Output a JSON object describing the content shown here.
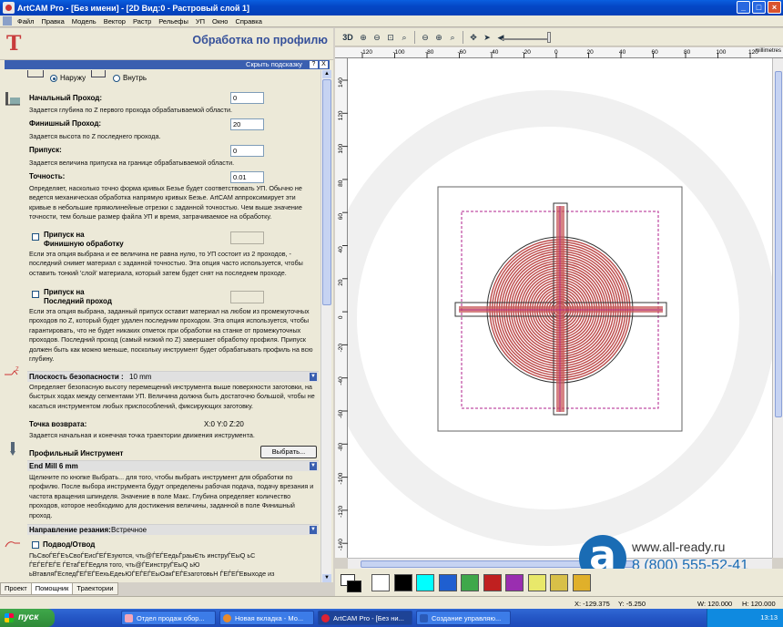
{
  "window": {
    "title": "ArtCAM Pro - [Без имени] - [2D Вид:0 - Растровый слой 1]",
    "buttons": [
      "_",
      "□",
      "×"
    ]
  },
  "menu": [
    "Файл",
    "Правка",
    "Модель",
    "Вектор",
    "Растр",
    "Рельефы",
    "УП",
    "Окно",
    "Справка"
  ],
  "panel": {
    "title": "Обработка по профилю",
    "hint_bar": "Скрыть подсказку",
    "hint_help": "?",
    "hint_close": "X",
    "side": {
      "outside_label": "Наружу",
      "inside_label": "Внутрь",
      "selected": "outside"
    },
    "start_pass": {
      "label": "Начальный Проход:",
      "value": "0",
      "desc": "Задается глубина по Z первого прохода обрабатываемой области."
    },
    "finish_pass": {
      "label": "Финишный Проход:",
      "value": "20",
      "desc": "Задается высота по Z последнего прохода."
    },
    "allowance": {
      "label": "Припуск:",
      "value": "0",
      "desc": "Задается величина припуска на границе обрабатываемой области."
    },
    "tolerance": {
      "label": "Точность:",
      "value": "0.01",
      "desc": "Определяет, насколько точно форма кривых Безье будет соответствовать УП. Обычно не ведется механическая обработка напрямую кривых Безье. ArtCAM аппроксимирует эти кривые в небольшие прямолинейные отрезки с заданной точностью. Чем выше значение точности, тем больше размер файла УП и время, затрачиваемое на обработку."
    },
    "finish_allowance": {
      "label_line1": "Припуск на",
      "label_line2": "Финишную обработку",
      "desc": "Если эта опция выбрана и ее величина не равна нулю, то УП состоит из 2 проходов, - последний снимет материал с заданной точностью. Эта опция часто используется, чтобы оставить тонкий 'слой' материала, который затем будет снят на последнем проходе."
    },
    "last_pass_allowance": {
      "label_line1": "Припуск на",
      "label_line2": "Последний проход",
      "desc": "Если эта опция выбрана, заданный припуск оставит материал на любом из промежуточных проходов по Z, который будет удален последним проходом. Эта опция используется, чтобы гарантировать, что не будет никаких отметок при обработки на станке от промежуточных проходов. Последний проход (самый низкий по Z) завершает обработку профиля. Припуск должен быть как можно меньше, поскольку инструмент будет обрабатывать профиль на всю глубину."
    },
    "safe_z": {
      "label": "Плоскость безопасности :",
      "value": "10 mm",
      "desc": "Определяет безопасную высоту перемещений инструмента выше поверхности заготовки, на быстрых ходах между сегментами УП. Величина должна быть достаточно большой, чтобы не касаться инструментом любых приспособлений, фиксирующих заготовку."
    },
    "home": {
      "label": "Точка возврата:",
      "value": "X:0 Y:0 Z:20",
      "desc": "Задается начальная и конечная точка траектории движения инструмента."
    },
    "tool": {
      "label": "Профильный Инструмент",
      "button": "Выбрать...",
      "name": "End Mill 6 mm",
      "desc": "Щелкните по кнопке Выбрать... для того, чтобы выбрать инструмент для обработки по профилю. После выбора инструмента будут определены рабочая подача, подачу врезания и частота вращения шпинделя. Значение в поле Макс. Глубина определяет количество проходов, которое необходимо для достижения величины, заданной в поле Финишный проход."
    },
    "cut_direction": {
      "label": "Направление резания:",
      "value": "Встречное"
    },
    "lead": {
      "label": "Подвод/Отвод",
      "garbled1": "ПьСвоЃЕЃЕъСвоЃЕисЃЕЃЕзуются, чть@ЃЕЃЕедьЃраыЄть инструЃЕыQ ьС",
      "garbled2": "ЃЕЃЕЃЕЃЕ ЃЕтаЃЕЃЕедля того, чть@ЃЕинструЃЕыQ ьЮ",
      "garbled3": "ьВтавляЃЕспедЃЕЃЕЃЕехьЕдеьЮЃЕЃЕЃЕыОакЃЕЃЕзаготовьН ЃЕЃЕЃЕвыходе из"
    }
  },
  "bottom_tabs": [
    "Проект",
    "Помощник",
    "Траектории"
  ],
  "view_toolbar": {
    "mode_3d": "3D"
  },
  "ruler": {
    "units": "millimetres",
    "top_ticks": [
      "-120",
      "-100",
      "-80",
      "-60",
      "-40",
      "-20",
      "0",
      "20",
      "40",
      "60",
      "80",
      "100",
      "120"
    ],
    "left_ticks": [
      "140",
      "120",
      "100",
      "80",
      "60",
      "40",
      "20",
      "0",
      "-20",
      "-40",
      "-60",
      "-80",
      "-100",
      "-120",
      "-140"
    ]
  },
  "palette": {
    "colors": [
      "#ffffff",
      "#000000",
      "#00ffff",
      "#1f5fd0",
      "#3fa84a",
      "#c02020",
      "#9a2eb0",
      "#e8e86a",
      "#d8c048",
      "#e0b02a"
    ]
  },
  "status": {
    "x": "X: -129.375",
    "y": "Y: -5.250",
    "w": "W: 120.000",
    "h": "H: 120.000"
  },
  "taskbar": {
    "start": "пуск",
    "tasks": [
      "Отдел продаж обор...",
      "Новая вкладка - Мо...",
      "ArtCAM Pro - [Без ни...",
      "Создание управляю..."
    ],
    "lang": "EN",
    "time": "13:13"
  },
  "brand": {
    "site": "www.all-ready.ru",
    "phone": "8 (800) 555-52-41"
  },
  "colors": {
    "accent": "#3a5fb0",
    "toolpath": "#b02a2a",
    "boundary": "#b0208c"
  }
}
